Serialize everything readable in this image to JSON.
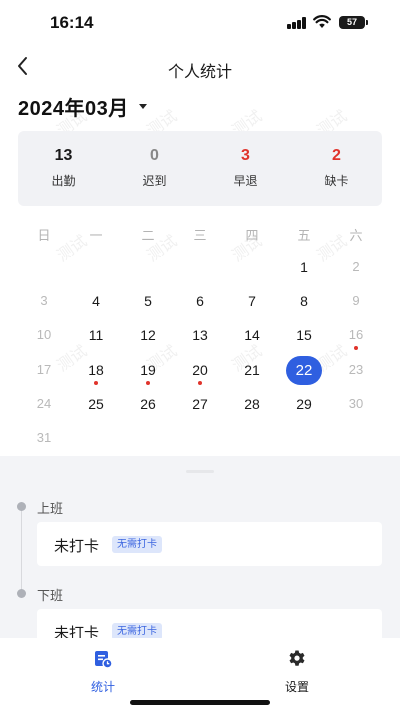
{
  "status_bar": {
    "time": "16:14",
    "battery": "57"
  },
  "nav": {
    "title": "个人统计"
  },
  "month": {
    "label": "2024年03月"
  },
  "stats": [
    {
      "value": "13",
      "label": "出勤",
      "color": "#1a1a1a"
    },
    {
      "value": "0",
      "label": "迟到",
      "color": "#888888"
    },
    {
      "value": "3",
      "label": "早退",
      "color": "#e0332b"
    },
    {
      "value": "2",
      "label": "缺卡",
      "color": "#e0332b"
    }
  ],
  "calendar": {
    "weekdays": [
      "日",
      "一",
      "二",
      "三",
      "四",
      "五",
      "六"
    ],
    "selected_day": "22",
    "abnormal_days": [
      "16",
      "18",
      "19",
      "20"
    ],
    "rows": [
      [
        "",
        "",
        "",
        "",
        "",
        "1",
        "2"
      ],
      [
        "3",
        "4",
        "5",
        "6",
        "7",
        "8",
        "9"
      ],
      [
        "10",
        "11",
        "12",
        "13",
        "14",
        "15",
        "16"
      ],
      [
        "17",
        "18",
        "19",
        "20",
        "21",
        "22",
        "23"
      ],
      [
        "24",
        "25",
        "26",
        "27",
        "28",
        "29",
        "30"
      ],
      [
        "31",
        "",
        "",
        "",
        "",
        "",
        ""
      ]
    ]
  },
  "records": [
    {
      "section": "上班",
      "status": "未打卡",
      "tag": "无需打卡"
    },
    {
      "section": "下班",
      "status": "未打卡",
      "tag": "无需打卡"
    }
  ],
  "tabs": [
    {
      "label": "统计",
      "icon": "calendar-stats-icon",
      "active": true,
      "color": "#2f5fe0"
    },
    {
      "label": "设置",
      "icon": "gear-icon",
      "active": false,
      "color": "#1a1a1a"
    }
  ],
  "watermark": "测试"
}
